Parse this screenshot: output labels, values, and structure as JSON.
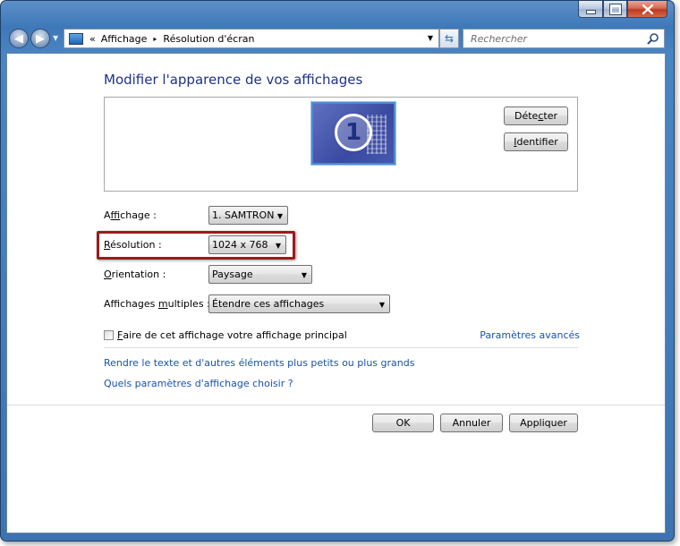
{
  "window": {
    "controls": {
      "minimize": "minimize",
      "maximize": "maximize",
      "close": "close"
    }
  },
  "nav": {
    "breadcrumb_prefix": "«",
    "breadcrumb": [
      "Affichage",
      "Résolution d'écran"
    ],
    "breadcrumb_sep": "▸",
    "search_placeholder": "Rechercher"
  },
  "page": {
    "title": "Modifier l'apparence de vos affichages",
    "monitor_number": "1",
    "detect_button": {
      "before": "Déte",
      "accel": "c",
      "after": "ter"
    },
    "identify_button": {
      "before": "",
      "accel": "I",
      "after": "dentifier"
    }
  },
  "settings": {
    "display": {
      "label_before": "A",
      "label_accel": "f",
      "label_after": "fichage :",
      "value": "1. SAMTRON"
    },
    "resolution": {
      "label_before": "",
      "label_accel": "R",
      "label_after": "ésolution :",
      "value": "1024 x 768"
    },
    "orientation": {
      "label_before": "",
      "label_accel": "O",
      "label_after": "rientation :",
      "value": "Paysage"
    },
    "multiple": {
      "label_before": "Affichages ",
      "label_accel": "m",
      "label_after": "ultiples :",
      "value": "Étendre ces affichages"
    }
  },
  "primary_checkbox": {
    "accel": "F",
    "label_rest": "aire de cet affichage votre affichage principal",
    "checked": false
  },
  "links": {
    "advanced": "Paramètres avancés",
    "text_size": "Rendre le texte et d'autres éléments plus petits ou plus grands",
    "which_settings": "Quels paramètres d'affichage choisir ?"
  },
  "buttons": {
    "ok": "OK",
    "cancel": "Annuler",
    "apply": "Appliquer"
  },
  "colors": {
    "title": "#1e3287",
    "link": "#1a51b0",
    "highlight_border": "#9b1b1b",
    "frame": "#3e78b8"
  }
}
